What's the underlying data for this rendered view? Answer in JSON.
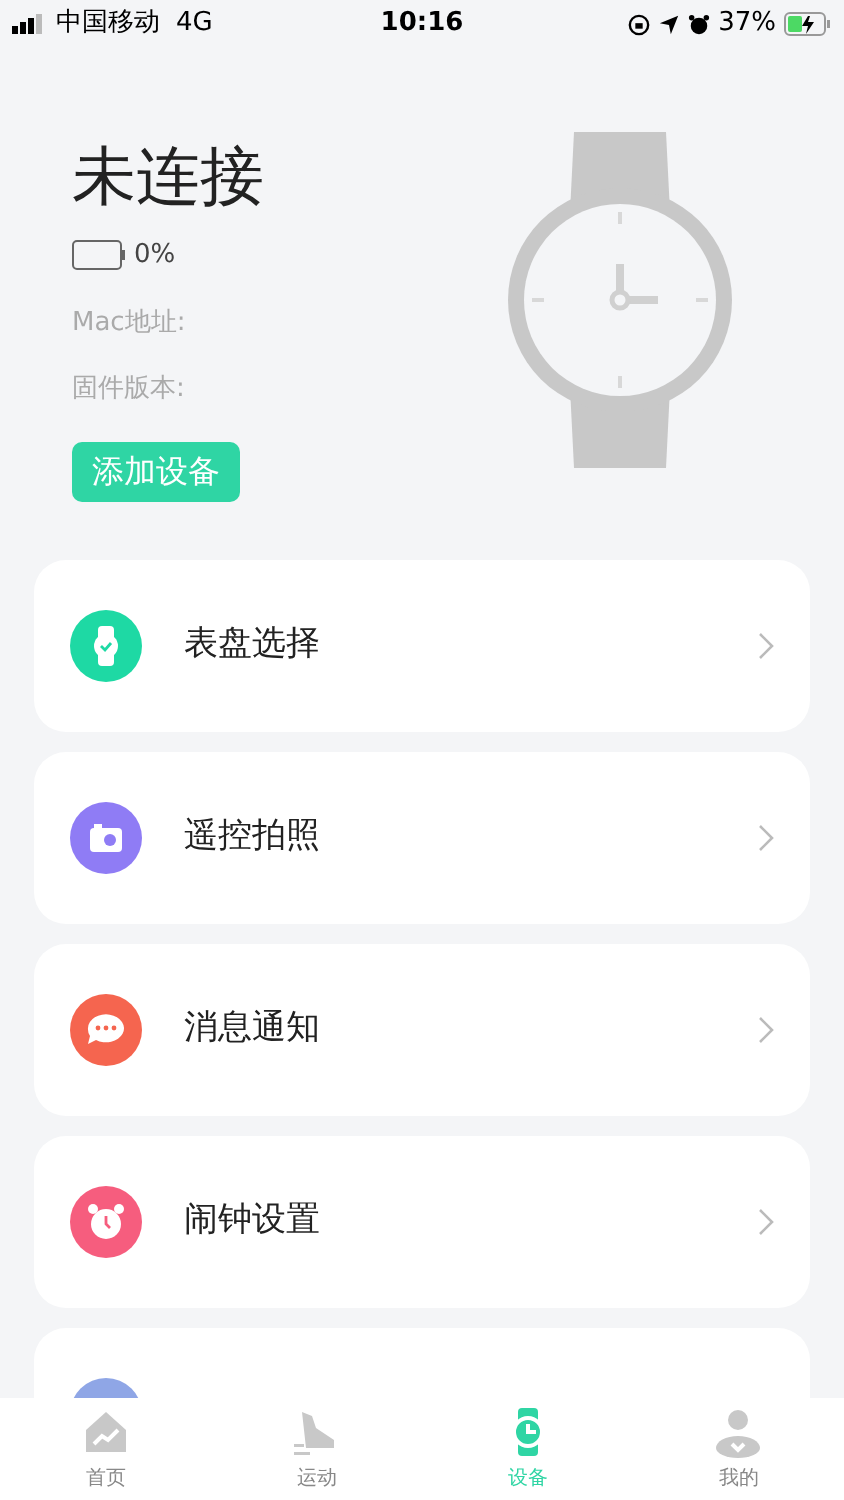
{
  "status_bar": {
    "carrier": "中国移动",
    "network": "4G",
    "time": "10:16",
    "battery": "37%"
  },
  "device": {
    "title": "未连接",
    "battery_text": "0%",
    "mac_label": "Mac地址:",
    "firmware_label": "固件版本:",
    "add_button": "添加设备"
  },
  "menu": [
    {
      "kind": "watchface",
      "label": "表盘选择",
      "color": "#1ed9a4"
    },
    {
      "kind": "camera",
      "label": "遥控拍照",
      "color": "#8f7cf5"
    },
    {
      "kind": "message",
      "label": "消息通知",
      "color": "#f5654f"
    },
    {
      "kind": "alarm",
      "label": "闹钟设置",
      "color": "#f65d7e"
    },
    {
      "kind": "settings",
      "color": "#8fa6e6"
    }
  ],
  "tabs": [
    {
      "kind": "home",
      "label": "首页",
      "selected": false
    },
    {
      "kind": "sport",
      "label": "运动",
      "selected": false
    },
    {
      "kind": "device",
      "label": "设备",
      "selected": true
    },
    {
      "kind": "me",
      "label": "我的",
      "selected": false
    }
  ]
}
